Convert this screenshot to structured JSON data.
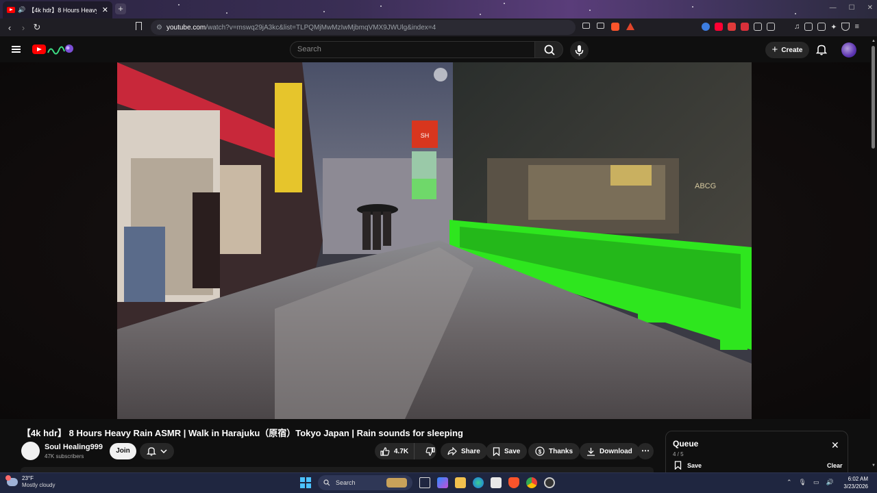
{
  "browser": {
    "tab_title": "【4k hdr】8 Hours Heavy Rain",
    "url_host": "youtube.com",
    "url_path": "/watch?v=mswq29jA3kc&list=TLPQMjMwMzIwMjbmqVMX9JWUlg&index=4",
    "new_tab": "+"
  },
  "youtube": {
    "search_placeholder": "Search",
    "create_label": "Create"
  },
  "video": {
    "title": "【4k hdr】 8 Hours Heavy Rain ASMR | Walk in Harajuku（原宿）Tokyo Japan | Rain sounds for sleeping",
    "channel_name": "Soul Healing999",
    "subscribers": "47K subscribers",
    "join_label": "Join",
    "like_count": "4.7K",
    "share_label": "Share",
    "save_label": "Save",
    "thanks_label": "Thanks",
    "download_label": "Download",
    "store_sign": "ABCG",
    "sign_red": "SH"
  },
  "queue": {
    "title": "Queue",
    "position": "4 / 5",
    "save_label": "Save",
    "clear_label": "Clear"
  },
  "taskbar": {
    "temperature": "23°F",
    "weather": "Mostly cloudy",
    "search_label": "Search",
    "time": "6:02 AM",
    "date": "3/23/2026"
  },
  "colors": {
    "youtube_red": "#ff0000",
    "fence_green": "#2ee61e",
    "taskbar_bg": "#1f2640"
  }
}
